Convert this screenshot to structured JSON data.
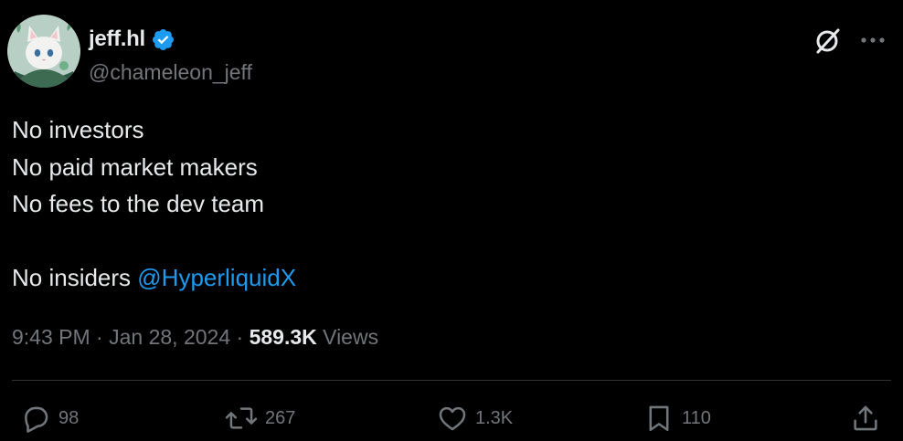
{
  "author": {
    "display_name": "jeff.hl",
    "handle": "@chameleon_jeff",
    "verified": true,
    "avatar": "cat-avatar"
  },
  "tweet": {
    "lines": [
      "No investors",
      "No paid market makers",
      "No fees to the dev team"
    ],
    "final_line_text": "No insiders ",
    "mention": "@HyperliquidX"
  },
  "meta": {
    "time": "9:43 PM",
    "separator": " · ",
    "date": "Jan 28, 2024",
    "views_count": "589.3K",
    "views_label": " Views"
  },
  "actions": {
    "replies": "98",
    "reposts": "267",
    "likes": "1.3K",
    "bookmarks": "110"
  },
  "icons": {
    "grok": "grok-icon",
    "more": "more-dots-icon",
    "reply": "reply-icon",
    "repost": "repost-icon",
    "like": "heart-icon",
    "bookmark": "bookmark-icon",
    "share": "share-icon",
    "verified": "verified-badge-icon"
  },
  "colors": {
    "background": "#000000",
    "text": "#e7e9ea",
    "muted": "#71767b",
    "link": "#1d9bf0",
    "divider": "#2f3336"
  }
}
